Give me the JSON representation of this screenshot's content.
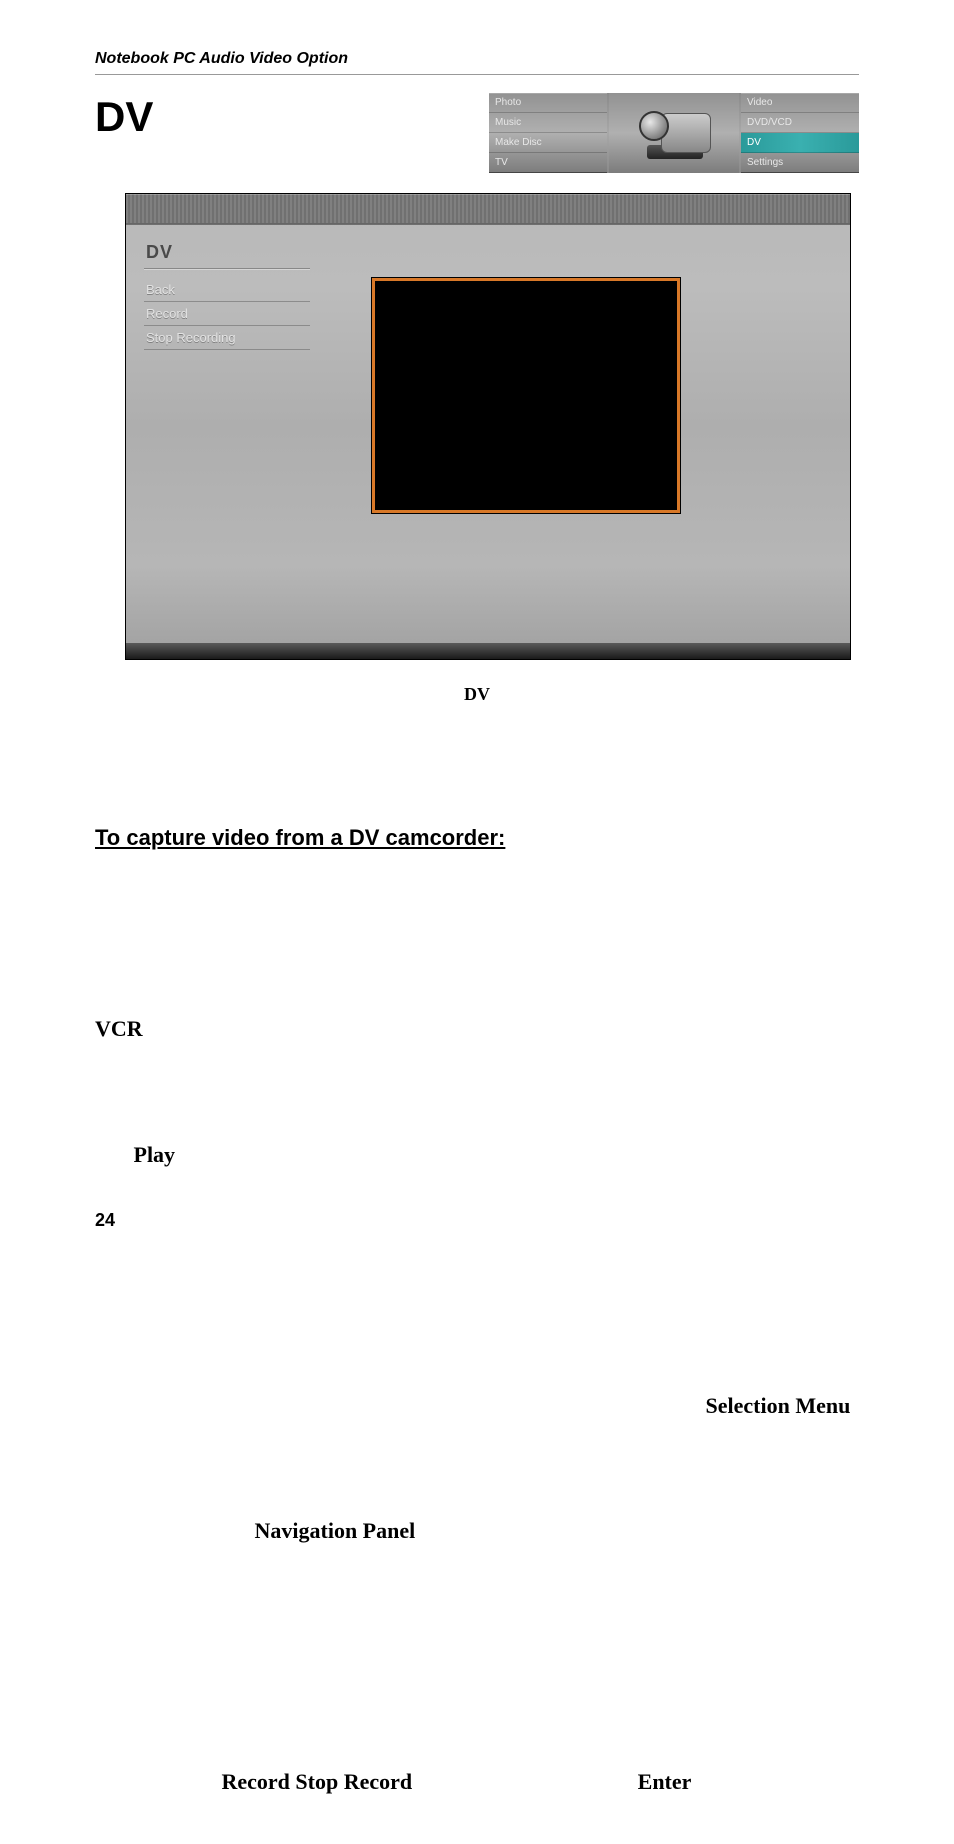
{
  "header": {
    "title": "Notebook PC Audio Video Option"
  },
  "page_title": "DV",
  "top_menu": {
    "left": [
      "Photo",
      "Music",
      "Make Disc",
      "TV"
    ],
    "right": [
      "Video",
      "DVD/VCD",
      "DV",
      "Settings"
    ],
    "right_selected_index": 2
  },
  "dv_panel": {
    "title": "DV",
    "items": [
      "Back",
      "Record",
      "Stop Recording"
    ]
  },
  "caption": "DV",
  "instructions": {
    "heading": "To capture video from a DV camcorder:",
    "words": {
      "vcr": "VCR",
      "play": "Play",
      "selection_menu": "Selection Menu",
      "navigation_panel": "Navigation Panel",
      "record_stop": "Record Stop",
      "record": "Record",
      "enter": "Enter"
    }
  },
  "page_number": "24"
}
